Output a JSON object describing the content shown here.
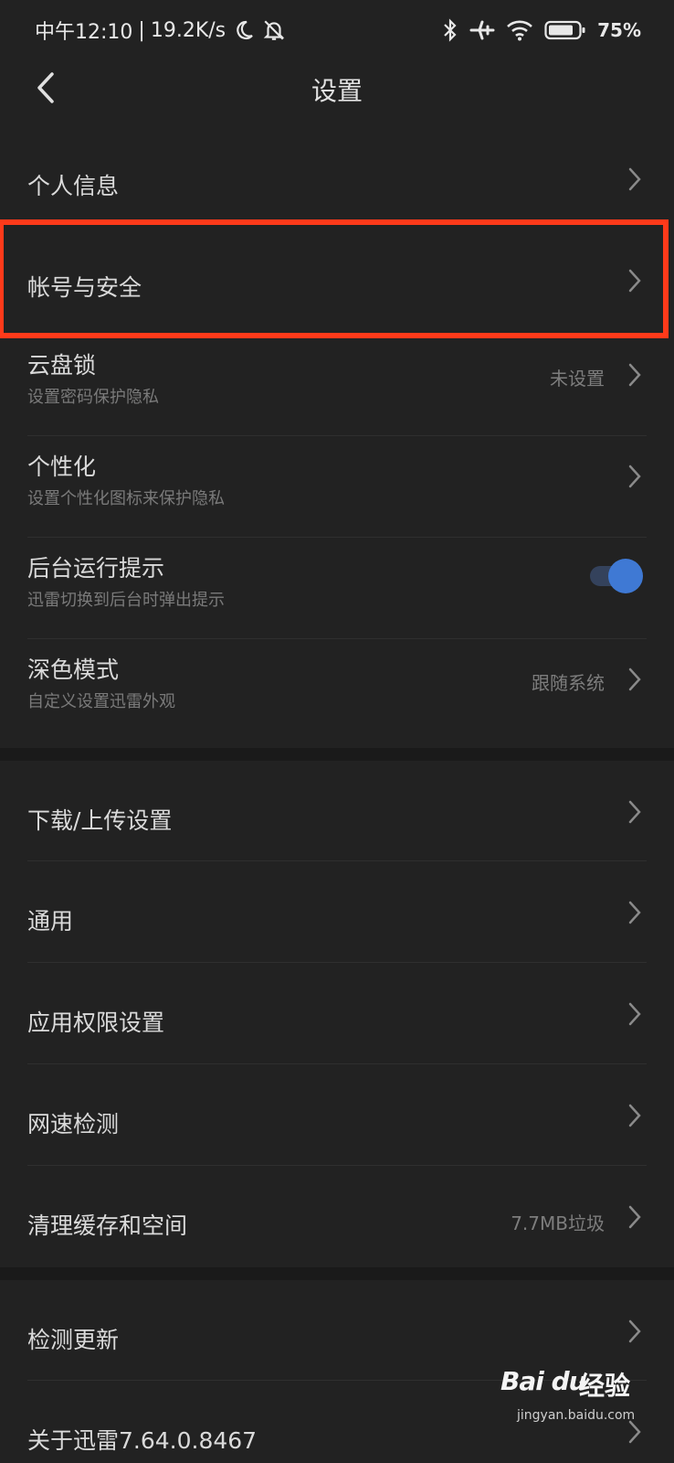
{
  "status_bar": {
    "time": "中午12:10",
    "separator": "|",
    "speed": "19.2K/s",
    "battery": "75%",
    "icons": [
      "moon-icon",
      "bell-off-icon",
      "bluetooth-icon",
      "airplane-icon",
      "wifi-icon",
      "battery-icon"
    ]
  },
  "header": {
    "title": "设置",
    "back_icon": "chevron-left-icon"
  },
  "group1": {
    "items": [
      {
        "title": "个人信息"
      },
      {
        "title": "帐号与安全"
      },
      {
        "title": "云盘锁",
        "subtitle": "设置密码保护隐私",
        "value": "未设置"
      },
      {
        "title": "个性化",
        "subtitle": "设置个性化图标来保护隐私"
      },
      {
        "title": "后台运行提示",
        "subtitle": "迅雷切换到后台时弹出提示",
        "toggle_on": true
      },
      {
        "title": "深色模式",
        "subtitle": "自定义设置迅雷外观",
        "value": "跟随系统"
      }
    ]
  },
  "group2": {
    "items": [
      {
        "title": "下载/上传设置"
      },
      {
        "title": "通用"
      },
      {
        "title": "应用权限设置"
      },
      {
        "title": "网速检测"
      },
      {
        "title": "清理缓存和空间",
        "value": "7.7MB垃圾"
      }
    ]
  },
  "group3": {
    "items": [
      {
        "title": "检测更新"
      },
      {
        "title": "关于迅雷7.64.0.8467"
      }
    ]
  },
  "colors": {
    "background": "#1a1a1a",
    "surface": "#222222",
    "highlight": "#ff3a1a",
    "toggle_accent": "#3f79d4"
  },
  "watermark": {
    "brand": "Bai du",
    "suffix": "经验",
    "domain": "jingyan.baidu.com"
  }
}
